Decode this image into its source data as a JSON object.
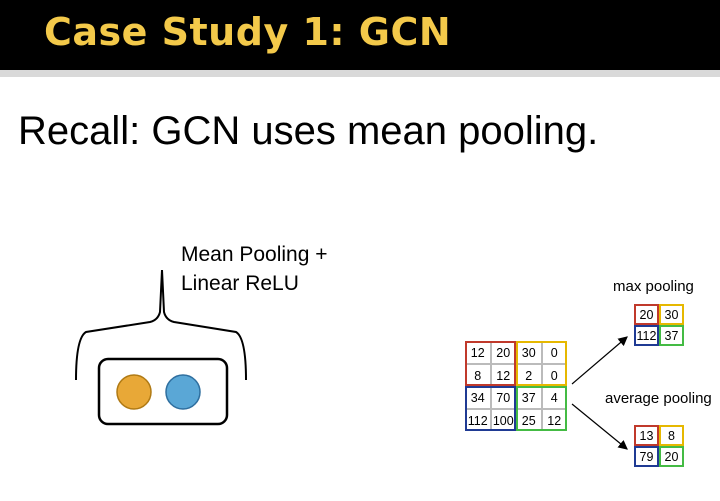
{
  "header": {
    "title": "Case Study 1: GCN"
  },
  "subtitle": "Recall: GCN uses mean pooling.",
  "left_figure": {
    "caption_line1": "Mean Pooling +",
    "caption_line2": "Linear ReLU",
    "node_colors": [
      "#e8a837",
      "#5aa7d6"
    ]
  },
  "pooling_figure": {
    "input_grid": [
      [
        "12",
        "20",
        "30",
        "0"
      ],
      [
        "8",
        "12",
        "2",
        "0"
      ],
      [
        "34",
        "70",
        "37",
        "4"
      ],
      [
        "112",
        "100",
        "25",
        "12"
      ]
    ],
    "max_label": "max pooling",
    "max_grid": [
      [
        "20",
        "30"
      ],
      [
        "112",
        "37"
      ]
    ],
    "avg_label": "average pooling",
    "avg_grid": [
      [
        "13",
        "8"
      ],
      [
        "79",
        "20"
      ]
    ],
    "quadrant_colors": [
      "#c0392b",
      "#e6b800",
      "#1f3a93",
      "#44bb44"
    ]
  }
}
